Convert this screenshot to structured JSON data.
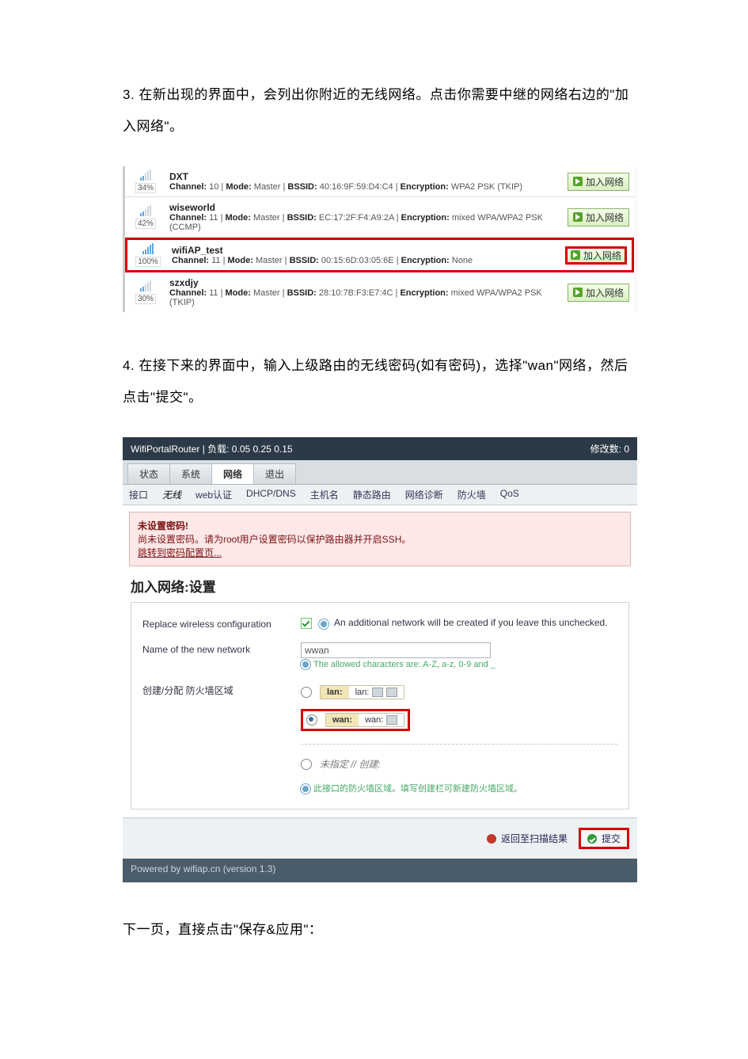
{
  "instruction_3": "3. 在新出现的界面中，会列出你附近的无线网络。点击你需要中继的网络右边的\"加入网络\"。",
  "instruction_4": "4. 在接下来的界面中，输入上级路由的无线密码(如有密码)，选择\"wan\"网络，然后点击\"提交\"。",
  "instruction_next": "下一页，直接点击\"保存&应用\"：",
  "netlist": {
    "join_label": "加入网络",
    "items": [
      {
        "percent": "34%",
        "ssid": "DXT",
        "meta_html": "Channel: 10 | Mode: Master | BSSID: 40:16:9F:59:D4:C4 | Encryption: WPA2 PSK (TKIP)",
        "hl": false,
        "bars_on": 2
      },
      {
        "percent": "42%",
        "ssid": "wiseworld",
        "meta_html": "Channel: 11 | Mode: Master | BSSID: EC:17:2F:F4:A9:2A | Encryption: mixed WPA/WPA2 PSK (CCMP)",
        "hl": false,
        "bars_on": 2
      },
      {
        "percent": "100%",
        "ssid": "wifiAP_test",
        "meta_html": "Channel: 11 | Mode: Master | BSSID: 00:15:6D:03:05:6E | Encryption: None",
        "hl": true,
        "bars_on": 5
      },
      {
        "percent": "30%",
        "ssid": "szxdjy",
        "meta_html": "Channel: 11 | Mode: Master | BSSID: 28:10:7B:F3:E7:4C | Encryption: mixed WPA/WPA2 PSK (TKIP)",
        "hl": false,
        "bars_on": 2
      }
    ]
  },
  "luci": {
    "header_left": "WifiPortalRouter | 负载: 0.05 0.25 0.15",
    "header_right": "修改数: 0",
    "top_tabs": {
      "t0": "状态",
      "t1": "系统",
      "t2": "网络",
      "t3": "退出"
    },
    "sub_tabs": {
      "s0": "接口",
      "s1": "无线",
      "s2": "web认证",
      "s3": "DHCP/DNS",
      "s4": "主机名",
      "s5": "静态路由",
      "s6": "网络诊断",
      "s7": "防火墙",
      "s8": "QoS"
    },
    "warn_title": "未设置密码!",
    "warn_body": "尚未设置密码。请为root用户设置密码以保护路由器并开启SSH。",
    "warn_link": "跳转到密码配置页...",
    "section_title": "加入网络:设置",
    "row_replace_label": "Replace wireless configuration",
    "row_replace_hint": "An additional network will be created if you leave this unchecked.",
    "row_name_label": "Name of the new network",
    "row_name_value": "wwan",
    "row_name_hint": "The allowed characters are: A-Z, a-z, 0-9 and _",
    "row_zone_label": "创建/分配 防火墙区域",
    "zones": {
      "lan_tag": "lan:",
      "lan_if": "lan:",
      "wan_tag": "wan:",
      "wan_if": "wan:",
      "none": "未指定 // 创建:"
    },
    "zone_hint": "此接口的防火墙区域。填写创建栏可新建防火墙区域。",
    "back_label": "返回至扫描结果",
    "submit_label": "提交",
    "powered": "Powered by wifiap.cn (version 1.3)"
  }
}
